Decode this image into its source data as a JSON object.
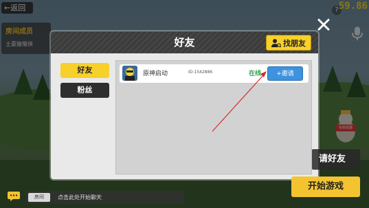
{
  "hud": {
    "back_label": "返回",
    "fps": "59.86",
    "help_label": "?"
  },
  "room": {
    "title": "房间成员",
    "member": "土豪猿猴侠"
  },
  "dialog": {
    "title": "好友",
    "find_button": "找朋友",
    "tabs": [
      {
        "label": "好友",
        "active": true
      },
      {
        "label": "粉丝",
        "active": false
      }
    ],
    "friends": [
      {
        "name": "原神启动",
        "id": "ID:1542886",
        "status": "在线",
        "invite_label": "+邀请"
      }
    ]
  },
  "buttons": {
    "invite_friend": "请好友",
    "start_game": "开始游戏"
  },
  "chat": {
    "room_tag": "房间",
    "placeholder": "点击此处开始聊天"
  },
  "npc": {
    "badge": "花枝招展"
  },
  "colors": {
    "accent_yellow": "#f7d02a",
    "invite_blue": "#3d93de",
    "online_green": "#2ea24a",
    "fps_yellow": "#f7d92a",
    "annotation_red": "#d42a2a"
  },
  "icons": {
    "back": "arrow-left-icon",
    "help": "question-icon",
    "mic": "microphone-icon",
    "close": "close-icon",
    "find": "user-search-icon",
    "chat": "chat-bubble-icon"
  }
}
